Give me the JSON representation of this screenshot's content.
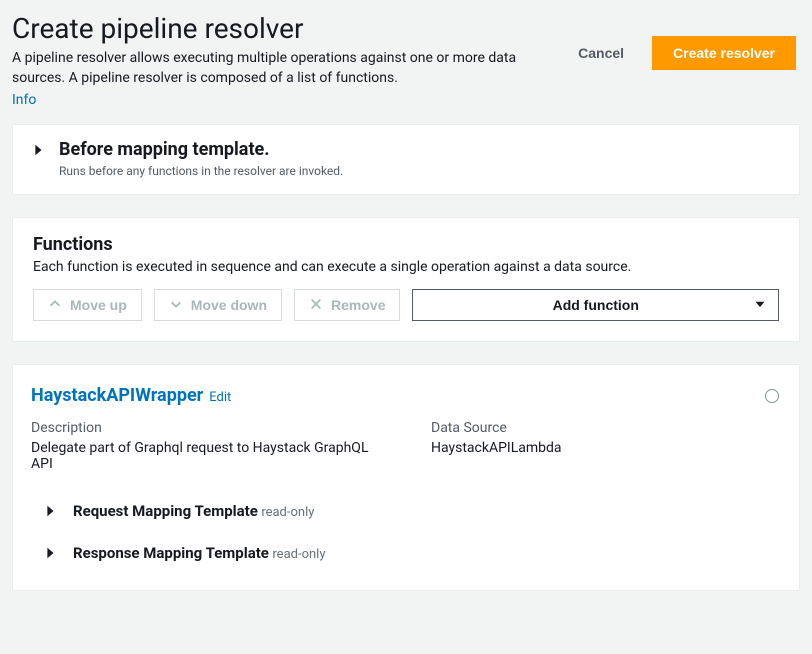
{
  "header": {
    "title": "Create pipeline resolver",
    "description": "A pipeline resolver allows executing multiple operations against one or more data sources. A pipeline resolver is composed of a list of functions.",
    "info": "Info",
    "cancel": "Cancel",
    "create": "Create resolver"
  },
  "before": {
    "title": "Before mapping template.",
    "subtitle": "Runs before any functions in the resolver are invoked."
  },
  "functions": {
    "title": "Functions",
    "description": "Each function is executed in sequence and can execute a single operation against a data source.",
    "move_up": "Move up",
    "move_down": "Move down",
    "remove": "Remove",
    "add": "Add function"
  },
  "fn": {
    "name": "HaystackAPIWrapper",
    "edit": "Edit",
    "desc_label": "Description",
    "desc": "Delegate part of Graphql request to Haystack GraphQL API",
    "ds_label": "Data Source",
    "ds": "HaystackAPILambda",
    "req_template": "Request Mapping Template",
    "res_template": "Response Mapping Template",
    "readonly": "read-only"
  }
}
